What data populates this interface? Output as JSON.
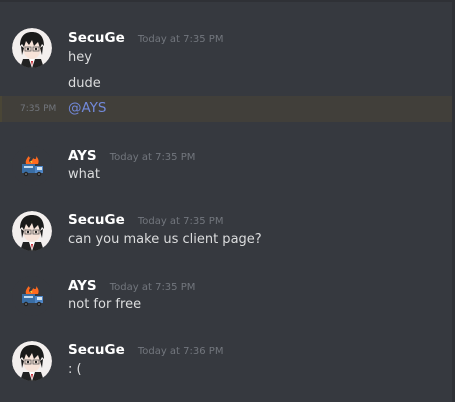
{
  "messages": [
    {
      "author": "SecuGe",
      "timestamp": "Today at 7:35 PM",
      "lines": [
        "hey",
        "dude"
      ],
      "mention_time": "7:35 PM",
      "mention": "@AYS"
    },
    {
      "author": "AYS",
      "timestamp": "Today at 7:35 PM",
      "lines": [
        "what"
      ]
    },
    {
      "author": "SecuGe",
      "timestamp": "Today at 7:35 PM",
      "lines": [
        "can you make us client page?"
      ]
    },
    {
      "author": "AYS",
      "timestamp": "Today at 7:35 PM",
      "lines": [
        "not for free"
      ]
    },
    {
      "author": "SecuGe",
      "timestamp": "Today at 7:36 PM",
      "lines": [
        ": ("
      ]
    }
  ],
  "icons": {
    "secuge_avatar": "anime-avatar-icon",
    "ays_avatar": "fire-truck-icon"
  }
}
